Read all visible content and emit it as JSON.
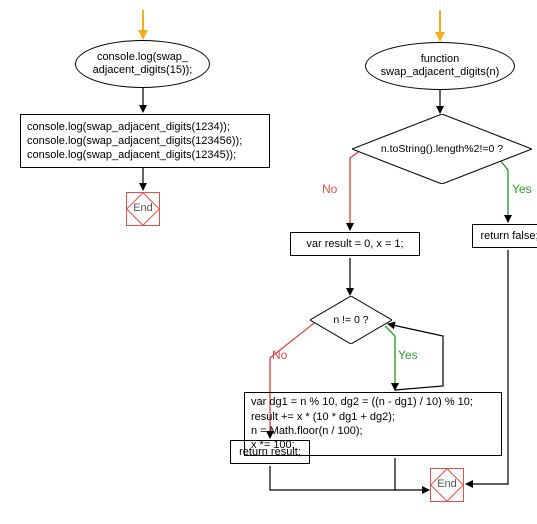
{
  "left": {
    "start_label": "console.log(swap_\nadjacent_digits(15));",
    "code_block": "console.log(swap_adjacent_digits(1234));\nconsole.log(swap_adjacent_digits(123456));\nconsole.log(swap_adjacent_digits(12345));",
    "end_label": "End"
  },
  "right": {
    "func_label": "function\nswap_adjacent_digits(n)",
    "cond1": "n.toString().length%2!=0\n?",
    "cond1_yes": "Yes",
    "cond1_no": "No",
    "return_false": "return false;",
    "init_block": "var result = 0, x = 1;",
    "cond2": "n != 0 ?",
    "cond2_yes": "Yes",
    "cond2_no": "No",
    "loop_block": "var dg1 = n % 10, dg2 = ((n - dg1) / 10) % 10;\nresult += x * (10 * dg1 + dg2);\nn = Math.floor(n / 100);\nx *= 100;",
    "return_result": "return result;",
    "end_label": "End"
  },
  "chart_data": {
    "type": "flowchart",
    "nodes": [
      {
        "id": "L_start",
        "shape": "ellipse",
        "text": "console.log(swap_adjacent_digits(15));"
      },
      {
        "id": "L_block",
        "shape": "rect",
        "text": "console.log(swap_adjacent_digits(1234));\nconsole.log(swap_adjacent_digits(123456));\nconsole.log(swap_adjacent_digits(12345));"
      },
      {
        "id": "L_end",
        "shape": "terminator",
        "text": "End"
      },
      {
        "id": "R_start",
        "shape": "ellipse",
        "text": "function swap_adjacent_digits(n)"
      },
      {
        "id": "R_cond1",
        "shape": "decision",
        "text": "n.toString().length%2!=0 ?"
      },
      {
        "id": "R_retfalse",
        "shape": "rect",
        "text": "return false;"
      },
      {
        "id": "R_init",
        "shape": "rect",
        "text": "var result = 0, x = 1;"
      },
      {
        "id": "R_cond2",
        "shape": "decision",
        "text": "n != 0 ?"
      },
      {
        "id": "R_loop",
        "shape": "rect",
        "text": "var dg1 = n % 10, dg2 = ((n - dg1) / 10) % 10;\nresult += x * (10 * dg1 + dg2);\nn = Math.floor(n / 100);\nx *= 100;"
      },
      {
        "id": "R_retres",
        "shape": "rect",
        "text": "return result;"
      },
      {
        "id": "R_end",
        "shape": "terminator",
        "text": "End"
      }
    ],
    "edges": [
      {
        "from": "L_start",
        "to": "L_block"
      },
      {
        "from": "L_block",
        "to": "L_end"
      },
      {
        "from": "R_start",
        "to": "R_cond1"
      },
      {
        "from": "R_cond1",
        "to": "R_retfalse",
        "label": "Yes"
      },
      {
        "from": "R_cond1",
        "to": "R_init",
        "label": "No"
      },
      {
        "from": "R_init",
        "to": "R_cond2"
      },
      {
        "from": "R_cond2",
        "to": "R_loop",
        "label": "Yes"
      },
      {
        "from": "R_loop",
        "to": "R_cond2"
      },
      {
        "from": "R_cond2",
        "to": "R_retres",
        "label": "No"
      },
      {
        "from": "R_retres",
        "to": "R_end"
      },
      {
        "from": "R_retfalse",
        "to": "R_end"
      }
    ],
    "colors": {
      "yes": "#2e9e2e",
      "no": "#d9534f",
      "arrow_entry": "#f2b01e",
      "stroke": "#000000"
    }
  }
}
